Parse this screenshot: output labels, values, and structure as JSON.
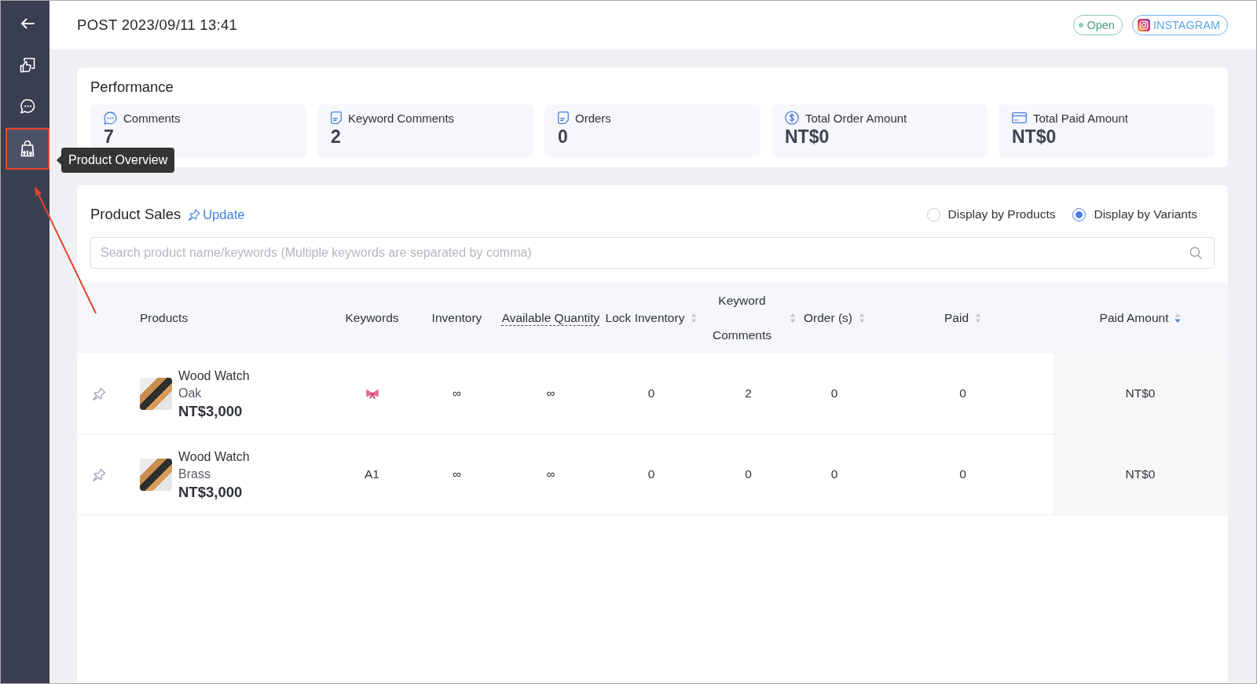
{
  "sidebar": {
    "items": [
      {
        "kind": "back",
        "selected": false
      },
      {
        "kind": "post",
        "selected": false
      },
      {
        "kind": "comments",
        "selected": false
      },
      {
        "kind": "products",
        "selected": true
      }
    ]
  },
  "tooltip": {
    "text": "Product Overview"
  },
  "header": {
    "title": "POST 2023/09/11 13:41",
    "status": "Open",
    "platform": "INSTAGRAM"
  },
  "performance": {
    "title": "Performance",
    "stats": [
      {
        "kind": "comments",
        "label": "Comments",
        "value": "7"
      },
      {
        "kind": "document",
        "label": "Keyword Comments",
        "value": "2"
      },
      {
        "kind": "document",
        "label": "Orders",
        "value": "0"
      },
      {
        "kind": "dollar",
        "label": "Total Order Amount",
        "value": "NT$0"
      },
      {
        "kind": "card",
        "label": "Total Paid Amount",
        "value": "NT$0"
      }
    ]
  },
  "product_sales": {
    "title": "Product Sales",
    "update_link": "Update",
    "view_options": [
      {
        "label": "Display by Products",
        "selected": false
      },
      {
        "label": "Display by Variants",
        "selected": true
      }
    ],
    "search": {
      "placeholder": "Search product name/keywords (Multiple keywords are separated by comma)"
    },
    "table": {
      "columns": [
        {
          "label": "Products",
          "kind": "plain",
          "hint": false
        },
        {
          "label": "Keywords",
          "kind": "plain",
          "hint": false
        },
        {
          "label": "Inventory",
          "kind": "plain",
          "hint": false
        },
        {
          "label": "Available Quantity",
          "kind": "plain",
          "hint": true
        },
        {
          "label": "Lock Inventory",
          "kind": "sortable",
          "sort_descending": false,
          "hint": false
        },
        {
          "label": "Keyword Comments",
          "kind": "sortable",
          "sort_descending": false,
          "hint": false
        },
        {
          "label": "Order (s)",
          "kind": "sortable",
          "sort_descending": false,
          "hint": false
        },
        {
          "label": "Paid",
          "kind": "sortable",
          "sort_descending": false,
          "hint": false
        },
        {
          "label": "Paid Amount",
          "kind": "sortable",
          "sort_descending": true,
          "hint": false
        }
      ],
      "rows": [
        {
          "pinned": false,
          "name": "Wood Watch",
          "variant": "Oak",
          "price": "NT$3,000",
          "keyword": {
            "kind": "icon"
          },
          "inventory": "∞",
          "available_quantity": "∞",
          "lock_inventory": "0",
          "keyword_comments": "2",
          "orders": "0",
          "paid": "0",
          "paid_amount": "NT$0"
        },
        {
          "pinned": false,
          "name": "Wood Watch",
          "variant": "Brass",
          "price": "NT$3,000",
          "keyword": {
            "kind": "text",
            "text": "A1"
          },
          "inventory": "∞",
          "available_quantity": "∞",
          "lock_inventory": "0",
          "keyword_comments": "0",
          "orders": "0",
          "paid": "0",
          "paid_amount": "NT$0"
        }
      ]
    }
  }
}
